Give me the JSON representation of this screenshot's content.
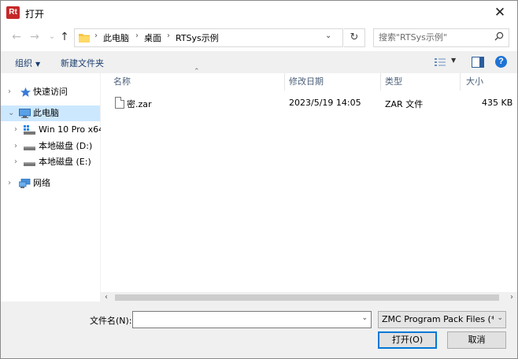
{
  "window": {
    "title": "打开",
    "app_icon_text": "Rt",
    "close_glyph": "✕"
  },
  "nav": {
    "back_glyph": "←",
    "forward_glyph": "→",
    "recent_glyph": "⌄",
    "up_glyph": "↑",
    "breadcrumb": [
      "此电脑",
      "桌面",
      "RTSys示例"
    ],
    "refresh_glyph": "↻",
    "search_placeholder": "搜索\"RTSys示例\""
  },
  "toolbar": {
    "organize": "组织",
    "new_folder": "新建文件夹",
    "help": "?"
  },
  "sidebar": {
    "items": [
      {
        "label": "快速访问",
        "icon": "star-icon"
      },
      {
        "label": "此电脑",
        "icon": "computer-icon"
      },
      {
        "label": "Win 10 Pro x64",
        "icon": "windows-drive-icon"
      },
      {
        "label": "本地磁盘 (D:)",
        "icon": "drive-icon"
      },
      {
        "label": "本地磁盘 (E:)",
        "icon": "drive-icon"
      },
      {
        "label": "网络",
        "icon": "network-icon"
      }
    ]
  },
  "columns": [
    "名称",
    "修改日期",
    "类型",
    "大小"
  ],
  "files": [
    {
      "name": "密.zar",
      "modified": "2023/5/19 14:05",
      "type": "ZAR 文件",
      "size": "435 KB"
    }
  ],
  "bottom": {
    "filename_label": "文件名(N):",
    "filename_value": "",
    "filetype_value": "ZMC Program Pack Files (*.z",
    "open_button": "打开(O)",
    "cancel_button": "取消"
  },
  "colors": {
    "accent": "#0078d7",
    "selected": "#cce8ff",
    "header_text": "#4c607a"
  }
}
